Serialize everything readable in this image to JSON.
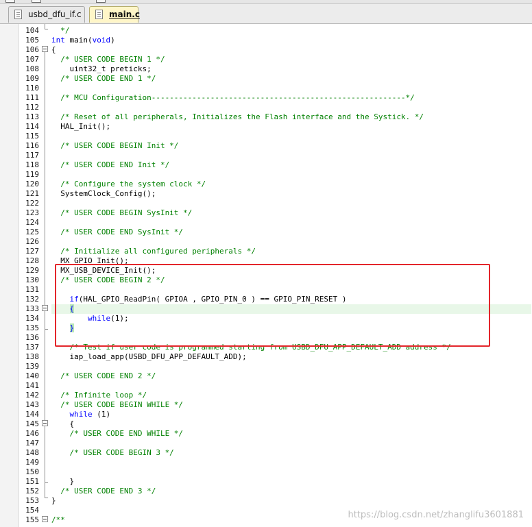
{
  "tabs": [
    {
      "label": "usbd_dfu_if.c",
      "active": false
    },
    {
      "label": "main.c",
      "active": true
    }
  ],
  "editor": {
    "highlighted_line": 133,
    "lines": [
      {
        "num": 104,
        "tokens": [
          {
            "t": "  */",
            "c": "cm"
          }
        ]
      },
      {
        "num": 105,
        "tokens": [
          {
            "t": "int",
            "c": "kw"
          },
          {
            "t": " main(",
            "c": "tx"
          },
          {
            "t": "void",
            "c": "kw"
          },
          {
            "t": ")",
            "c": "tx"
          }
        ]
      },
      {
        "num": 106,
        "tokens": [
          {
            "t": "{",
            "c": "tx"
          }
        ]
      },
      {
        "num": 107,
        "tokens": [
          {
            "t": "  /* USER CODE BEGIN 1 */",
            "c": "cm"
          }
        ]
      },
      {
        "num": 108,
        "tokens": [
          {
            "t": "    uint32_t preticks;",
            "c": "tx"
          }
        ]
      },
      {
        "num": 109,
        "tokens": [
          {
            "t": "  /* USER CODE END 1 */",
            "c": "cm"
          }
        ]
      },
      {
        "num": 110,
        "tokens": []
      },
      {
        "num": 111,
        "tokens": [
          {
            "t": "  /* MCU Configuration--------------------------------------------------------*/",
            "c": "cm"
          }
        ]
      },
      {
        "num": 112,
        "tokens": []
      },
      {
        "num": 113,
        "tokens": [
          {
            "t": "  /* Reset of all peripherals, Initializes the Flash interface and the Systick. */",
            "c": "cm"
          }
        ]
      },
      {
        "num": 114,
        "tokens": [
          {
            "t": "  HAL_Init();",
            "c": "tx"
          }
        ]
      },
      {
        "num": 115,
        "tokens": []
      },
      {
        "num": 116,
        "tokens": [
          {
            "t": "  /* USER CODE BEGIN Init */",
            "c": "cm"
          }
        ]
      },
      {
        "num": 117,
        "tokens": []
      },
      {
        "num": 118,
        "tokens": [
          {
            "t": "  /* USER CODE END Init */",
            "c": "cm"
          }
        ]
      },
      {
        "num": 119,
        "tokens": []
      },
      {
        "num": 120,
        "tokens": [
          {
            "t": "  /* Configure the system clock */",
            "c": "cm"
          }
        ]
      },
      {
        "num": 121,
        "tokens": [
          {
            "t": "  SystemClock_Config();",
            "c": "tx"
          }
        ]
      },
      {
        "num": 122,
        "tokens": []
      },
      {
        "num": 123,
        "tokens": [
          {
            "t": "  /* USER CODE BEGIN SysInit */",
            "c": "cm"
          }
        ]
      },
      {
        "num": 124,
        "tokens": []
      },
      {
        "num": 125,
        "tokens": [
          {
            "t": "  /* USER CODE END SysInit */",
            "c": "cm"
          }
        ]
      },
      {
        "num": 126,
        "tokens": []
      },
      {
        "num": 127,
        "tokens": [
          {
            "t": "  /* Initialize all configured peripherals */",
            "c": "cm"
          }
        ]
      },
      {
        "num": 128,
        "tokens": [
          {
            "t": "  MX_GPIO_Init();",
            "c": "tx"
          }
        ]
      },
      {
        "num": 129,
        "tokens": [
          {
            "t": "  MX_USB_DEVICE_Init();",
            "c": "tx"
          }
        ]
      },
      {
        "num": 130,
        "tokens": [
          {
            "t": "  /* USER CODE BEGIN 2 */",
            "c": "cm"
          }
        ]
      },
      {
        "num": 131,
        "tokens": []
      },
      {
        "num": 132,
        "tokens": [
          {
            "t": "    ",
            "c": "tx"
          },
          {
            "t": "if",
            "c": "kw"
          },
          {
            "t": "(HAL_GPIO_ReadPin( GPIOA , GPIO_PIN_0 ) == GPIO_PIN_RESET )",
            "c": "tx"
          }
        ]
      },
      {
        "num": 133,
        "tokens": [
          {
            "t": "    ",
            "c": "tx"
          },
          {
            "t": "{",
            "c": "br"
          }
        ]
      },
      {
        "num": 134,
        "tokens": [
          {
            "t": "        ",
            "c": "tx"
          },
          {
            "t": "while",
            "c": "kw"
          },
          {
            "t": "(1);",
            "c": "tx"
          }
        ]
      },
      {
        "num": 135,
        "tokens": [
          {
            "t": "    ",
            "c": "tx"
          },
          {
            "t": "}",
            "c": "br"
          }
        ]
      },
      {
        "num": 136,
        "tokens": []
      },
      {
        "num": 137,
        "tokens": [
          {
            "t": "    /* Test if user code is programmed starting from USBD_DFU_APP_DEFAULT_ADD address */",
            "c": "cm"
          }
        ]
      },
      {
        "num": 138,
        "tokens": [
          {
            "t": "    iap_load_app(USBD_DFU_APP_DEFAULT_ADD);",
            "c": "tx"
          }
        ]
      },
      {
        "num": 139,
        "tokens": []
      },
      {
        "num": 140,
        "tokens": [
          {
            "t": "  /* USER CODE END 2 */",
            "c": "cm"
          }
        ]
      },
      {
        "num": 141,
        "tokens": []
      },
      {
        "num": 142,
        "tokens": [
          {
            "t": "  /* Infinite loop */",
            "c": "cm"
          }
        ]
      },
      {
        "num": 143,
        "tokens": [
          {
            "t": "  /* USER CODE BEGIN WHILE */",
            "c": "cm"
          }
        ]
      },
      {
        "num": 144,
        "tokens": [
          {
            "t": "    ",
            "c": "tx"
          },
          {
            "t": "while",
            "c": "kw"
          },
          {
            "t": " (1)",
            "c": "tx"
          }
        ]
      },
      {
        "num": 145,
        "tokens": [
          {
            "t": "    {",
            "c": "tx"
          }
        ]
      },
      {
        "num": 146,
        "tokens": [
          {
            "t": "    /* USER CODE END WHILE */",
            "c": "cm"
          }
        ]
      },
      {
        "num": 147,
        "tokens": []
      },
      {
        "num": 148,
        "tokens": [
          {
            "t": "    /* USER CODE BEGIN 3 */",
            "c": "cm"
          }
        ]
      },
      {
        "num": 149,
        "tokens": []
      },
      {
        "num": 150,
        "tokens": []
      },
      {
        "num": 151,
        "tokens": [
          {
            "t": "    }",
            "c": "tx"
          }
        ]
      },
      {
        "num": 152,
        "tokens": [
          {
            "t": "  /* USER CODE END 3 */",
            "c": "cm"
          }
        ]
      },
      {
        "num": 153,
        "tokens": [
          {
            "t": "}",
            "c": "tx"
          }
        ]
      },
      {
        "num": 154,
        "tokens": []
      },
      {
        "num": 155,
        "tokens": [
          {
            "t": "/**",
            "c": "cm"
          }
        ]
      }
    ]
  },
  "watermark": "https://blog.csdn.net/zhanglifu3601881",
  "colors": {
    "keyword": "#0000ff",
    "comment": "#008000",
    "text": "#000000",
    "current_line": "#e8f7e8",
    "brace_match": "#b8e6b8",
    "selection_box": "#e3262b",
    "active_tab": "#fff6c8"
  }
}
